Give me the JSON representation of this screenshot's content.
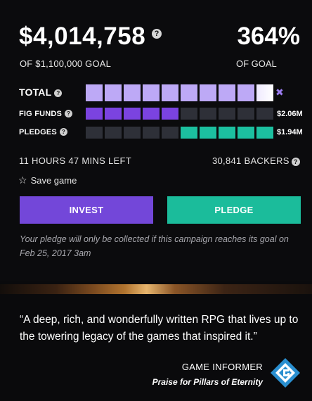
{
  "campaign": {
    "raised": "$4,014,758",
    "goal_text": "OF $1,100,000 GOAL",
    "percent": "364%",
    "percent_sub": "OF GOAL",
    "help_glyph": "?"
  },
  "bars": {
    "total_label": "TOTAL",
    "fig_label": "FIG FUNDS",
    "pledges_label": "PLEDGES",
    "fig_amount": "$2.06M",
    "pledge_amount": "$1.94M",
    "x_glyph": "✖",
    "segments": 10,
    "fig_filled": 5,
    "pledge_filled": 5
  },
  "stats": {
    "time_left": "11 HOURS 47 MINS LEFT",
    "backers": "30,841 BACKERS"
  },
  "actions": {
    "save_label": "Save game",
    "invest_label": "INVEST",
    "pledge_label": "PLEDGE"
  },
  "note": "Your pledge will only be collected if this campaign reaches its goal on Feb 25, 2017 3am",
  "review": {
    "quote": "“A deep, rich, and wonderfully written RPG that lives up to the towering legacy of the games that inspired it.”",
    "source": "GAME INFORMER",
    "praise": "Praise for Pillars of Eternity"
  },
  "colors": {
    "purple": "#7347d9",
    "teal": "#1bbc9b",
    "light_purple": "#bda9f6"
  },
  "icons": {
    "help": "question-circle-icon",
    "star": "star-outline-icon",
    "logo": "game-informer-logo-icon"
  }
}
